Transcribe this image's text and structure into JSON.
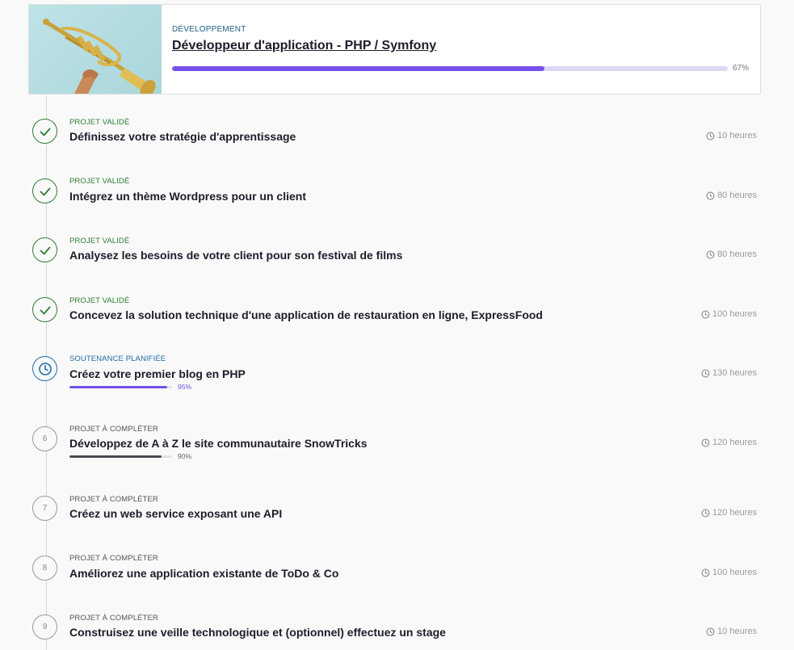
{
  "course": {
    "category": "DÉVELOPPEMENT",
    "title": "Développeur d'application - PHP / Symfony",
    "progress_percent": 67,
    "progress_label": "67%",
    "image_icon": "trumpet-image"
  },
  "colors": {
    "accent": "#7451eb",
    "validated": "#2e7d32",
    "planned": "#1e6fa8",
    "todo": "#555555"
  },
  "steps": [
    {
      "status": "PROJET VALIDÉ",
      "state": "validated",
      "title": "Définissez votre stratégie d'apprentissage",
      "duration": "10 heures"
    },
    {
      "status": "PROJET VALIDÉ",
      "state": "validated",
      "title": "Intégrez un thème Wordpress pour un client",
      "duration": "80 heures"
    },
    {
      "status": "PROJET VALIDÉ",
      "state": "validated",
      "title": "Analysez les besoins de votre client pour son festival de films",
      "duration": "80 heures"
    },
    {
      "status": "PROJET VALIDÉ",
      "state": "validated",
      "title": "Concevez la solution technique d'une application de restauration en ligne, ExpressFood",
      "duration": "100 heures"
    },
    {
      "status": "SOUTENANCE PLANIFIÉE",
      "state": "planned",
      "title": "Créez votre premier blog en PHP",
      "duration": "130 heures",
      "progress_percent": 95,
      "progress_label": "95%"
    },
    {
      "status": "PROJET À COMPLÉTER",
      "state": "todo",
      "number": "6",
      "title": "Développez de A à Z le site communautaire SnowTricks",
      "duration": "120 heures",
      "progress_percent": 90,
      "progress_label": "90%"
    },
    {
      "status": "PROJET À COMPLÉTER",
      "state": "todo",
      "number": "7",
      "title": "Créez un web service exposant une API",
      "duration": "120 heures"
    },
    {
      "status": "PROJET À COMPLÉTER",
      "state": "todo",
      "number": "8",
      "title": "Améliorez une application existante de ToDo & Co",
      "duration": "100 heures"
    },
    {
      "status": "PROJET À COMPLÉTER",
      "state": "todo",
      "number": "9",
      "title": "Construisez une veille technologique et (optionnel) effectuez un stage",
      "duration": "10 heures"
    }
  ]
}
